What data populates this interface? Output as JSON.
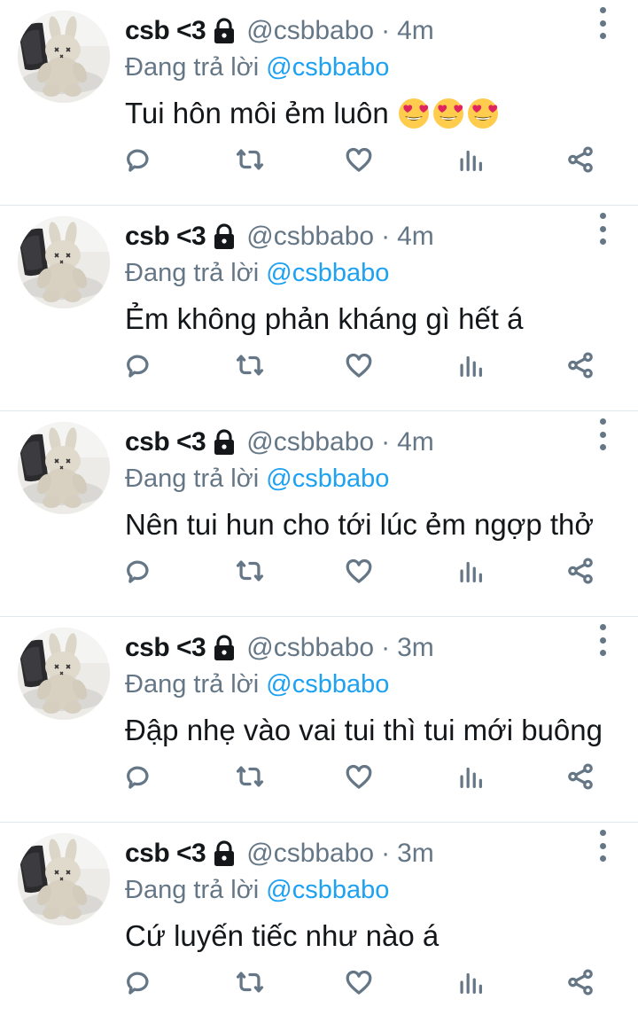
{
  "tweets": [
    {
      "name": "csb <3",
      "handle": "@csbbabo",
      "separator": "·",
      "time": "4m",
      "reply_prefix": "Đang trả lời",
      "reply_to": "@csbbabo",
      "text": "Tui hôn môi ẻm luôn",
      "emojis": [
        "heart-eyes-emoji",
        "heart-eyes-emoji",
        "heart-eyes-emoji"
      ]
    },
    {
      "name": "csb <3",
      "handle": "@csbbabo",
      "separator": "·",
      "time": "4m",
      "reply_prefix": "Đang trả lời",
      "reply_to": "@csbbabo",
      "text": "Ẻm không phản kháng gì hết á",
      "emojis": []
    },
    {
      "name": "csb <3",
      "handle": "@csbbabo",
      "separator": "·",
      "time": "4m",
      "reply_prefix": "Đang trả lời",
      "reply_to": "@csbbabo",
      "text": "Nên tui hun cho tới lúc ẻm ngợp thở",
      "emojis": []
    },
    {
      "name": "csb <3",
      "handle": "@csbbabo",
      "separator": "·",
      "time": "3m",
      "reply_prefix": "Đang trả lời",
      "reply_to": "@csbbabo",
      "text": "Đập nhẹ vào vai tui thì tui mới buông",
      "emojis": []
    },
    {
      "name": "csb <3",
      "handle": "@csbbabo",
      "separator": "·",
      "time": "3m",
      "reply_prefix": "Đang trả lời",
      "reply_to": "@csbbabo",
      "text": "Cứ luyến tiếc như nào á",
      "emojis": []
    }
  ],
  "icons": {
    "lock": "lock-icon",
    "more": "more-vertical-icon",
    "reply": "reply-icon",
    "retweet": "retweet-icon",
    "like": "heart-icon",
    "stats": "analytics-icon",
    "share": "share-icon"
  },
  "colors": {
    "link": "#1da1f2",
    "secondary_text": "#657786",
    "primary_text": "#14171a",
    "divider": "#e1e8ed"
  }
}
